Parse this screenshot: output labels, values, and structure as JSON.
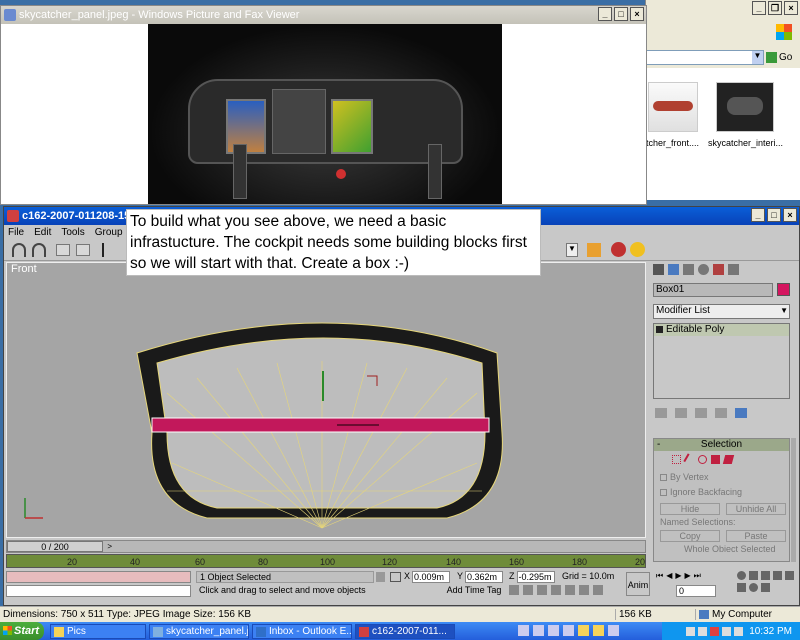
{
  "viewer": {
    "title": "skycatcher_panel.jpeg - Windows Picture and Fax Viewer"
  },
  "explorer": {
    "go_label": "Go",
    "thumb1_label": "tcher_front....",
    "thumb2_label": "skycatcher_interi..."
  },
  "max": {
    "title": "c162-2007-011208-15pi",
    "menu": [
      "File",
      "Edit",
      "Tools",
      "Group",
      "Vi"
    ],
    "viewport_label": "Front",
    "object_name": "Box01",
    "modifier_list": "Modifier List",
    "stack_item": "Editable Poly",
    "rollout_title": "Selection",
    "by_vertex": "By Vertex",
    "ignore_backfacing": "Ignore Backfacing",
    "hide_btn": "Hide",
    "unhide_btn": "Unhide All",
    "named_selections": "Named Selections:",
    "copy_btn": "Copy",
    "paste_btn": "Paste",
    "whole_object": "Whole Object Selected",
    "timeslider": "0 / 200",
    "ruler_labels": [
      "20",
      "40",
      "60",
      "80",
      "100",
      "120",
      "140",
      "160",
      "180",
      "20"
    ],
    "status_selected": "1 Object Selected",
    "status_prompt": "Click and drag to select and move objects",
    "x_label": "X",
    "x_value": "0.009m",
    "y_label": "Y",
    "y_value": "0.362m",
    "z_label": "Z",
    "z_value": "-0.295m",
    "grid": "Grid = 10.0m",
    "add_time_tag": "Add Time Tag",
    "anim_label": "Anim",
    "frame_value": "0"
  },
  "tooltip_text": "To build what you see above, we need a basic infrastucture.  The cockpit needs some building blocks first so we will start with that.  Create a box :-)",
  "explorer_status": {
    "dimensions": "Dimensions: 750 x 511 Type: JPEG Image Size: 156 KB",
    "size": "156 KB",
    "location": "My Computer"
  },
  "taskbar": {
    "start": "Start",
    "items": [
      "Pics",
      "skycatcher_panel.j...",
      "Inbox - Outlook E...",
      "c162-2007-011..."
    ],
    "clock": "10:32 PM"
  },
  "colors": {
    "xp_blue": "#0842b8",
    "viewport_bg": "#a5a5a5",
    "box_magenta": "#c2185b",
    "object_color": "#d4155f"
  }
}
